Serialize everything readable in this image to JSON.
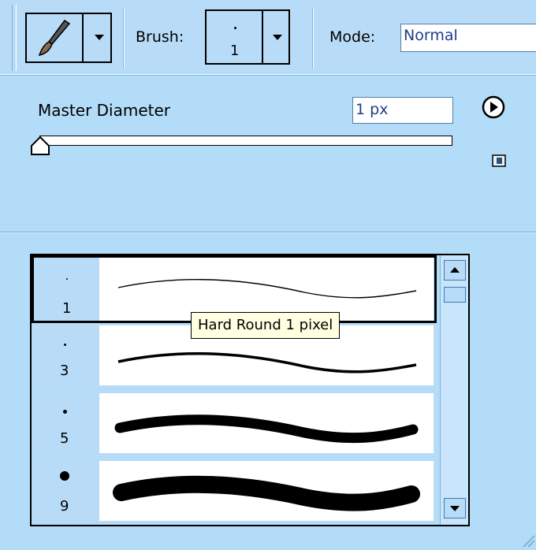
{
  "toolbar": {
    "tool_preset_icon": "brush-tool-icon",
    "brush_label": "Brush:",
    "brush_size": "1",
    "mode_label": "Mode:",
    "mode_value": "Normal"
  },
  "picker": {
    "master_diameter_label": "Master Diameter",
    "master_diameter_value": "1 px",
    "slider_level": 0.0,
    "menu_icon": "play-arrow-menu-icon",
    "new_preset_icon": "new-preset-icon"
  },
  "brushes": [
    {
      "size": "1",
      "selected": true
    },
    {
      "size": "3",
      "selected": false
    },
    {
      "size": "5",
      "selected": false
    },
    {
      "size": "9",
      "selected": false
    }
  ],
  "tooltip": "Hard Round 1 pixel",
  "colors": {
    "panel_bg": "#b3dcf8",
    "input_text": "#1f3e8a",
    "tooltip_bg": "#ffffe1"
  }
}
